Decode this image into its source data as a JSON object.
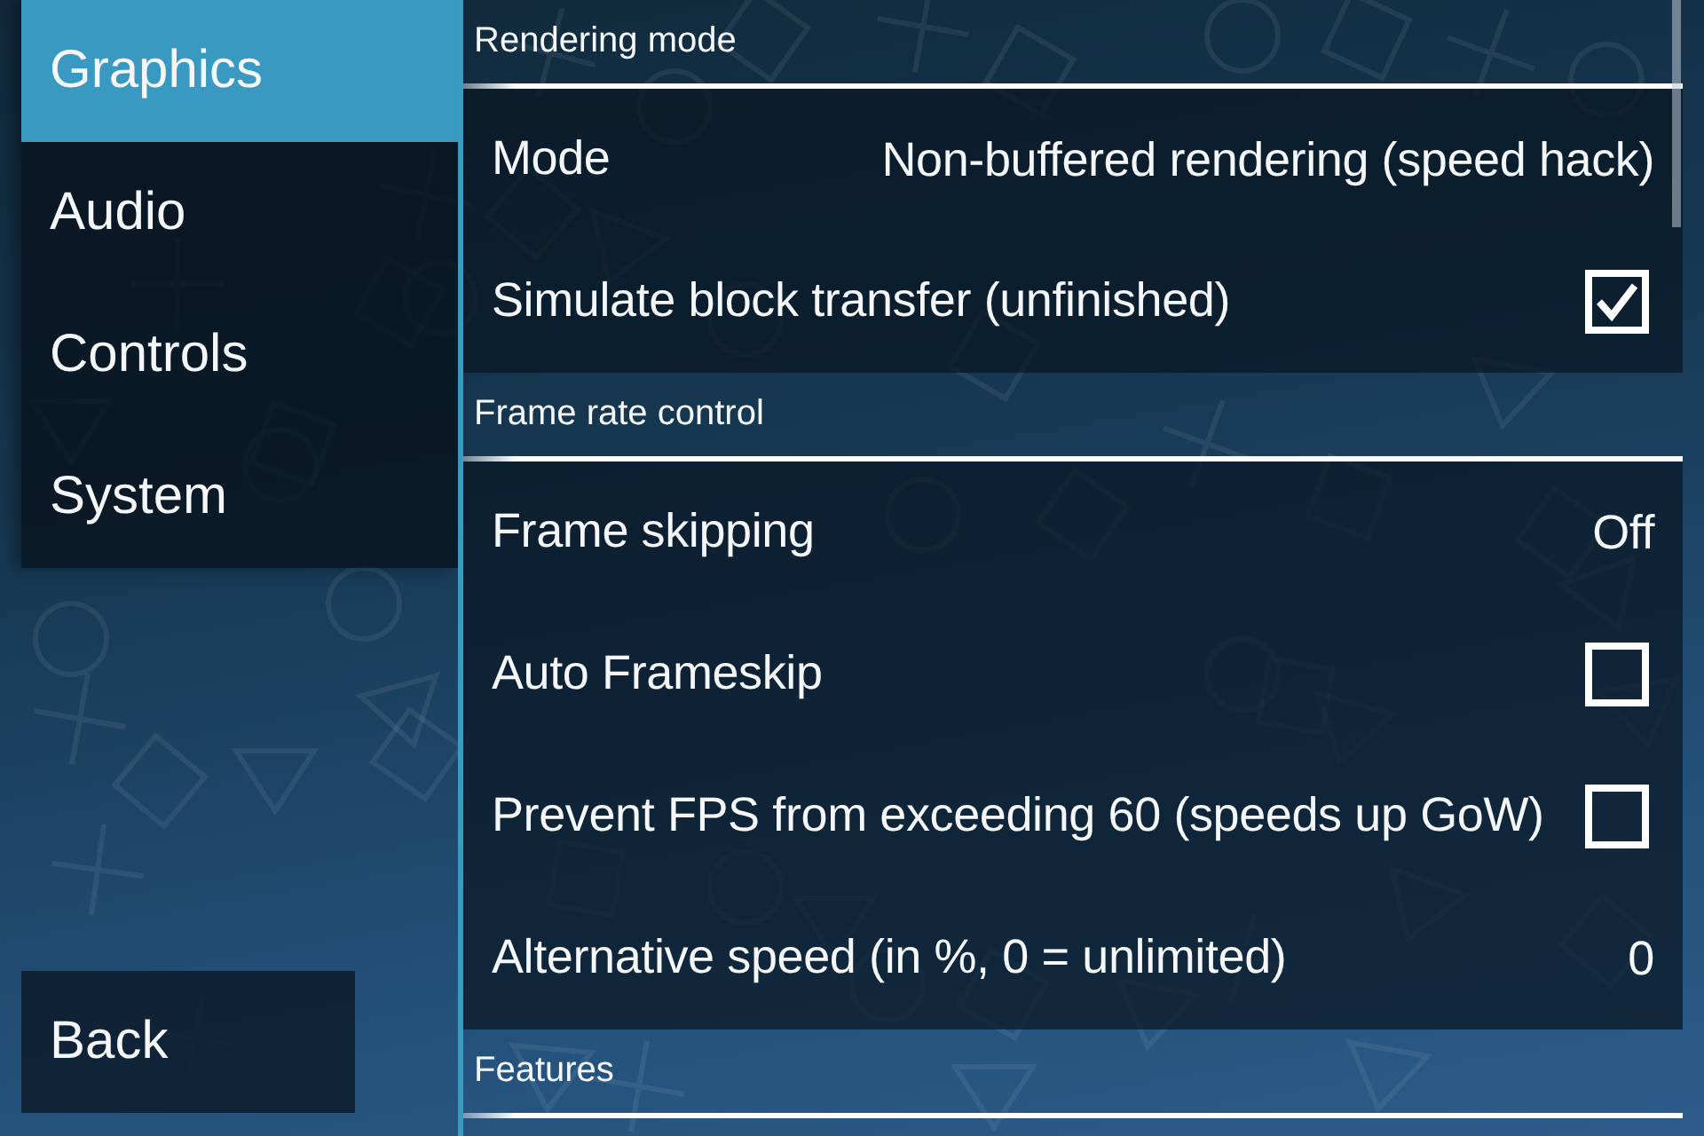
{
  "sidebar": {
    "tabs": [
      {
        "label": "Graphics",
        "selected": true
      },
      {
        "label": "Audio",
        "selected": false
      },
      {
        "label": "Controls",
        "selected": false
      },
      {
        "label": "System",
        "selected": false
      }
    ],
    "back_button": "Back"
  },
  "sections": [
    {
      "title": "Rendering mode",
      "items": [
        {
          "kind": "choice",
          "label": "Mode",
          "value": "Non-buffered rendering (speed hack)"
        },
        {
          "kind": "checkbox",
          "label": "Simulate block transfer (unfinished)",
          "checked": true
        }
      ]
    },
    {
      "title": "Frame rate control",
      "items": [
        {
          "kind": "choice",
          "label": "Frame skipping",
          "value": "Off"
        },
        {
          "kind": "checkbox",
          "label": "Auto Frameskip",
          "checked": false
        },
        {
          "kind": "checkbox",
          "label": "Prevent FPS from exceeding 60 (speeds up GoW)",
          "checked": false
        },
        {
          "kind": "choice",
          "label": "Alternative speed (in %, 0 = unlimited)",
          "value": "0"
        }
      ]
    },
    {
      "title": "Features"
    }
  ]
}
